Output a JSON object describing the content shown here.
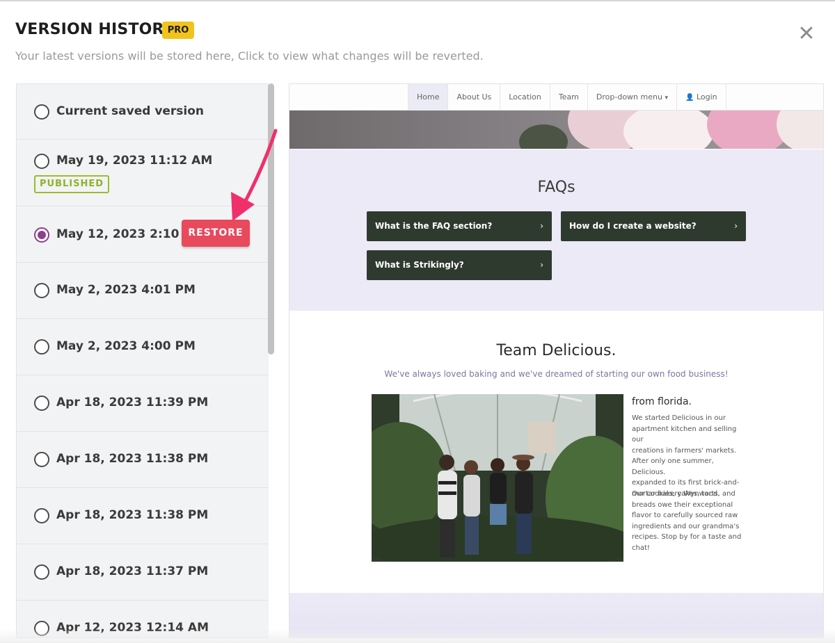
{
  "header": {
    "title": "VERSION HISTORY",
    "badge": "PRO",
    "subtitle": "Your latest versions will be stored here, Click to view what changes will be reverted.",
    "close_glyph": "✕"
  },
  "versions": [
    {
      "label": "Current saved version",
      "selected": false
    },
    {
      "label": "May 19, 2023 11:12 AM",
      "selected": false,
      "badge": "PUBLISHED"
    },
    {
      "label": "May 12, 2023 2:10 PM",
      "selected": true,
      "action": "RESTORE"
    },
    {
      "label": "May 2, 2023 4:01 PM",
      "selected": false
    },
    {
      "label": "May 2, 2023 4:00 PM",
      "selected": false
    },
    {
      "label": "Apr 18, 2023 11:39 PM",
      "selected": false
    },
    {
      "label": "Apr 18, 2023 11:38 PM",
      "selected": false
    },
    {
      "label": "Apr 18, 2023 11:38 PM",
      "selected": false
    },
    {
      "label": "Apr 18, 2023 11:37 PM",
      "selected": false
    },
    {
      "label": "Apr 12, 2023 12:14 AM",
      "selected": false
    }
  ],
  "preview": {
    "nav": [
      "Home",
      "About Us",
      "Location",
      "Team",
      "Drop-down menu",
      "Login"
    ],
    "nav_active": "Home",
    "faq": {
      "title": "FAQs",
      "items": [
        "What is the FAQ section?",
        "How do I create a website?",
        "What is Strikingly?"
      ]
    },
    "team": {
      "title": "Team Delicious.",
      "subtitle": "We've always loved baking and we've dreamed of starting our own food business!",
      "story_title": "from florida.",
      "paragraph_1_lines": [
        "We started Delicious in our",
        "apartment kitchen and selling our",
        "creations in farmers' markets.",
        "After only one summer, Delicious.",
        "expanded to its first brick-and-",
        "mortar bakery Wynwood."
      ],
      "paragraph_2_lines": [
        "Our cookies, cakes, tarts, and",
        "breads owe their exceptional",
        "flavor to carefully sourced raw",
        "ingredients and our grandma's",
        "recipes. Stop by for a taste and",
        "chat!"
      ]
    }
  },
  "colors": {
    "accent_purple": "#8d3f8d",
    "restore_red": "#e8495d",
    "published_green": "#9cbb2e",
    "pro_yellow": "#f2c31d",
    "arrow_pink": "#f0306a"
  }
}
